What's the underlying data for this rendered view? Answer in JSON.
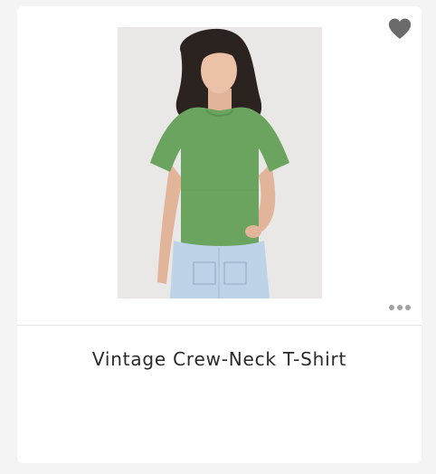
{
  "product": {
    "title": "Vintage Crew-Neck T-Shirt",
    "image_alt": "Model wearing green vintage crew-neck t-shirt with light wash jeans",
    "favorite_icon": "heart-icon",
    "more_icon": "more-dots-icon"
  },
  "colors": {
    "shirt": "#6aa45e",
    "jeans": "#bcd3e8",
    "icon": "#6b6b6b",
    "dots": "#a3a3a3"
  }
}
